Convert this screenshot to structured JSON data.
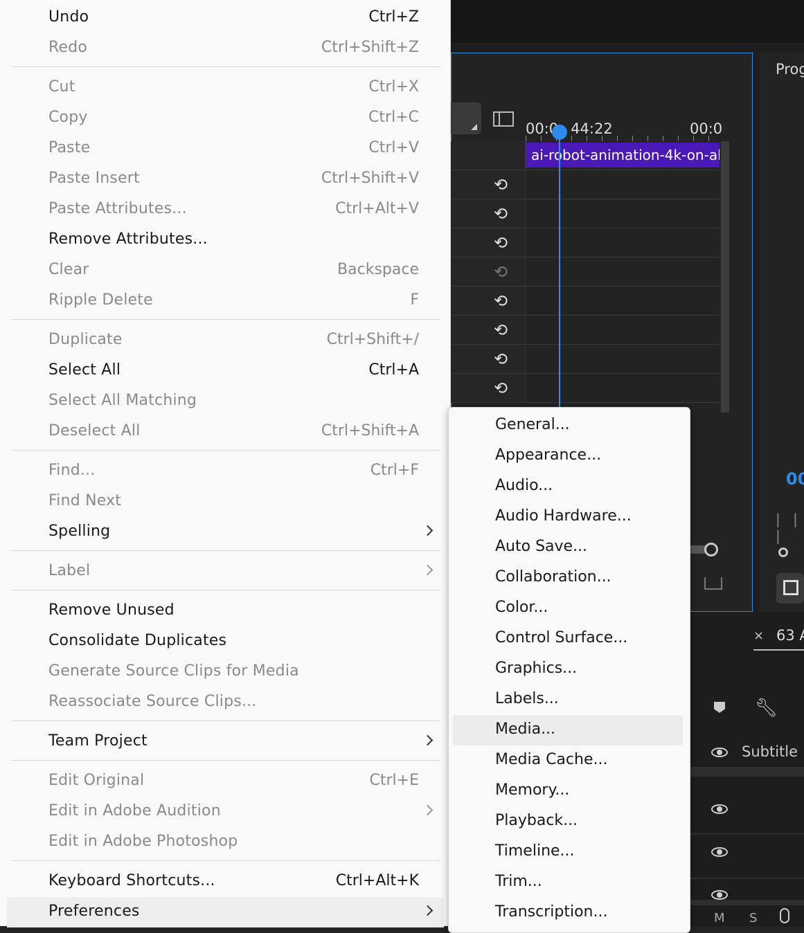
{
  "edit_menu": {
    "items": [
      {
        "label": "Undo",
        "shortcut": "Ctrl+Z",
        "enabled": true
      },
      {
        "label": "Redo",
        "shortcut": "Ctrl+Shift+Z",
        "enabled": false
      },
      {
        "label": "Cut",
        "shortcut": "Ctrl+X",
        "enabled": false
      },
      {
        "label": "Copy",
        "shortcut": "Ctrl+C",
        "enabled": false
      },
      {
        "label": "Paste",
        "shortcut": "Ctrl+V",
        "enabled": false
      },
      {
        "label": "Paste Insert",
        "shortcut": "Ctrl+Shift+V",
        "enabled": false
      },
      {
        "label": "Paste Attributes...",
        "shortcut": "Ctrl+Alt+V",
        "enabled": false
      },
      {
        "label": "Remove Attributes...",
        "shortcut": "",
        "enabled": true
      },
      {
        "label": "Clear",
        "shortcut": "Backspace",
        "enabled": false
      },
      {
        "label": "Ripple Delete",
        "shortcut": "F",
        "enabled": false
      },
      {
        "label": "Duplicate",
        "shortcut": "Ctrl+Shift+/",
        "enabled": false
      },
      {
        "label": "Select All",
        "shortcut": "Ctrl+A",
        "enabled": true
      },
      {
        "label": "Select All Matching",
        "shortcut": "",
        "enabled": false
      },
      {
        "label": "Deselect All",
        "shortcut": "Ctrl+Shift+A",
        "enabled": false
      },
      {
        "label": "Find...",
        "shortcut": "Ctrl+F",
        "enabled": false
      },
      {
        "label": "Find Next",
        "shortcut": "",
        "enabled": false
      },
      {
        "label": "Spelling",
        "shortcut": "",
        "enabled": true,
        "submenu": true
      },
      {
        "label": "Label",
        "shortcut": "",
        "enabled": false,
        "submenu": true
      },
      {
        "label": "Remove Unused",
        "shortcut": "",
        "enabled": true
      },
      {
        "label": "Consolidate Duplicates",
        "shortcut": "",
        "enabled": true
      },
      {
        "label": "Generate Source Clips for Media",
        "shortcut": "",
        "enabled": false
      },
      {
        "label": "Reassociate Source Clips...",
        "shortcut": "",
        "enabled": false
      },
      {
        "label": "Team Project",
        "shortcut": "",
        "enabled": true,
        "submenu": true
      },
      {
        "label": "Edit Original",
        "shortcut": "Ctrl+E",
        "enabled": false
      },
      {
        "label": "Edit in Adobe Audition",
        "shortcut": "",
        "enabled": false,
        "submenu": true
      },
      {
        "label": "Edit in Adobe Photoshop",
        "shortcut": "",
        "enabled": false
      },
      {
        "label": "Keyboard Shortcuts...",
        "shortcut": "Ctrl+Alt+K",
        "enabled": true
      },
      {
        "label": "Preferences",
        "shortcut": "",
        "enabled": true,
        "submenu": true,
        "highlighted": true
      }
    ]
  },
  "preferences_submenu": {
    "items": [
      {
        "label": "General..."
      },
      {
        "label": "Appearance..."
      },
      {
        "label": "Audio..."
      },
      {
        "label": "Audio Hardware..."
      },
      {
        "label": "Auto Save..."
      },
      {
        "label": "Collaboration..."
      },
      {
        "label": "Color..."
      },
      {
        "label": "Control Surface..."
      },
      {
        "label": "Graphics..."
      },
      {
        "label": "Labels..."
      },
      {
        "label": "Media...",
        "highlighted": true
      },
      {
        "label": "Media Cache..."
      },
      {
        "label": "Memory..."
      },
      {
        "label": "Playback..."
      },
      {
        "label": "Timeline..."
      },
      {
        "label": "Trim..."
      },
      {
        "label": "Transcription..."
      }
    ]
  },
  "background": {
    "timeline": {
      "timecode_left": "00:0",
      "timecode_left_tail": "44:22",
      "timecode_right": "00:0",
      "clip_name": "ai-robot-animation-4k-on-al"
    },
    "program_monitor": {
      "title": "Prog",
      "timecode": "00"
    },
    "lower_panel": {
      "tab_close": "×",
      "tab_label": "63 A",
      "track_label": "Subtitle",
      "mute_label": "M",
      "solo_label": "S"
    },
    "colors": {
      "accent_blue": "#2d8ceb",
      "clip_purple": "#4b18b8",
      "menu_bg": "#f9f9f9",
      "menu_highlight": "#ededed"
    }
  }
}
